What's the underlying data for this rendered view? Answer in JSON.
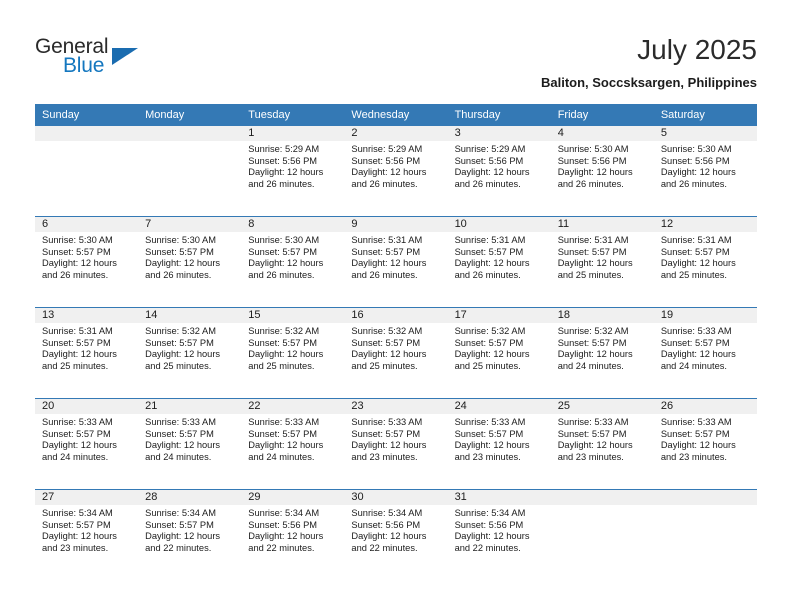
{
  "brand": {
    "name_top": "General",
    "name_bottom": "Blue",
    "triangle_icon": "triangle-icon",
    "color_dark": "#2a2a2a",
    "color_blue": "#1477bf"
  },
  "header": {
    "title": "July 2025",
    "subtitle": "Baliton, Soccsksargen, Philippines"
  },
  "theme": {
    "header_blue": "#3479b5",
    "daynum_band": "#f0f0f0",
    "text": "#1c1c1c"
  },
  "calendar": {
    "weekday_headers": [
      "Sunday",
      "Monday",
      "Tuesday",
      "Wednesday",
      "Thursday",
      "Friday",
      "Saturday"
    ],
    "labels": {
      "sunrise": "Sunrise:",
      "sunset": "Sunset:",
      "daylight": "Daylight:"
    },
    "weeks": [
      [
        {
          "day": ""
        },
        {
          "day": ""
        },
        {
          "day": "1",
          "sunrise": "Sunrise: 5:29 AM",
          "sunset": "Sunset: 5:56 PM",
          "daylight_1": "Daylight: 12 hours",
          "daylight_2": "and 26 minutes."
        },
        {
          "day": "2",
          "sunrise": "Sunrise: 5:29 AM",
          "sunset": "Sunset: 5:56 PM",
          "daylight_1": "Daylight: 12 hours",
          "daylight_2": "and 26 minutes."
        },
        {
          "day": "3",
          "sunrise": "Sunrise: 5:29 AM",
          "sunset": "Sunset: 5:56 PM",
          "daylight_1": "Daylight: 12 hours",
          "daylight_2": "and 26 minutes."
        },
        {
          "day": "4",
          "sunrise": "Sunrise: 5:30 AM",
          "sunset": "Sunset: 5:56 PM",
          "daylight_1": "Daylight: 12 hours",
          "daylight_2": "and 26 minutes."
        },
        {
          "day": "5",
          "sunrise": "Sunrise: 5:30 AM",
          "sunset": "Sunset: 5:56 PM",
          "daylight_1": "Daylight: 12 hours",
          "daylight_2": "and 26 minutes."
        }
      ],
      [
        {
          "day": "6",
          "sunrise": "Sunrise: 5:30 AM",
          "sunset": "Sunset: 5:57 PM",
          "daylight_1": "Daylight: 12 hours",
          "daylight_2": "and 26 minutes."
        },
        {
          "day": "7",
          "sunrise": "Sunrise: 5:30 AM",
          "sunset": "Sunset: 5:57 PM",
          "daylight_1": "Daylight: 12 hours",
          "daylight_2": "and 26 minutes."
        },
        {
          "day": "8",
          "sunrise": "Sunrise: 5:30 AM",
          "sunset": "Sunset: 5:57 PM",
          "daylight_1": "Daylight: 12 hours",
          "daylight_2": "and 26 minutes."
        },
        {
          "day": "9",
          "sunrise": "Sunrise: 5:31 AM",
          "sunset": "Sunset: 5:57 PM",
          "daylight_1": "Daylight: 12 hours",
          "daylight_2": "and 26 minutes."
        },
        {
          "day": "10",
          "sunrise": "Sunrise: 5:31 AM",
          "sunset": "Sunset: 5:57 PM",
          "daylight_1": "Daylight: 12 hours",
          "daylight_2": "and 26 minutes."
        },
        {
          "day": "11",
          "sunrise": "Sunrise: 5:31 AM",
          "sunset": "Sunset: 5:57 PM",
          "daylight_1": "Daylight: 12 hours",
          "daylight_2": "and 25 minutes."
        },
        {
          "day": "12",
          "sunrise": "Sunrise: 5:31 AM",
          "sunset": "Sunset: 5:57 PM",
          "daylight_1": "Daylight: 12 hours",
          "daylight_2": "and 25 minutes."
        }
      ],
      [
        {
          "day": "13",
          "sunrise": "Sunrise: 5:31 AM",
          "sunset": "Sunset: 5:57 PM",
          "daylight_1": "Daylight: 12 hours",
          "daylight_2": "and 25 minutes."
        },
        {
          "day": "14",
          "sunrise": "Sunrise: 5:32 AM",
          "sunset": "Sunset: 5:57 PM",
          "daylight_1": "Daylight: 12 hours",
          "daylight_2": "and 25 minutes."
        },
        {
          "day": "15",
          "sunrise": "Sunrise: 5:32 AM",
          "sunset": "Sunset: 5:57 PM",
          "daylight_1": "Daylight: 12 hours",
          "daylight_2": "and 25 minutes."
        },
        {
          "day": "16",
          "sunrise": "Sunrise: 5:32 AM",
          "sunset": "Sunset: 5:57 PM",
          "daylight_1": "Daylight: 12 hours",
          "daylight_2": "and 25 minutes."
        },
        {
          "day": "17",
          "sunrise": "Sunrise: 5:32 AM",
          "sunset": "Sunset: 5:57 PM",
          "daylight_1": "Daylight: 12 hours",
          "daylight_2": "and 25 minutes."
        },
        {
          "day": "18",
          "sunrise": "Sunrise: 5:32 AM",
          "sunset": "Sunset: 5:57 PM",
          "daylight_1": "Daylight: 12 hours",
          "daylight_2": "and 24 minutes."
        },
        {
          "day": "19",
          "sunrise": "Sunrise: 5:33 AM",
          "sunset": "Sunset: 5:57 PM",
          "daylight_1": "Daylight: 12 hours",
          "daylight_2": "and 24 minutes."
        }
      ],
      [
        {
          "day": "20",
          "sunrise": "Sunrise: 5:33 AM",
          "sunset": "Sunset: 5:57 PM",
          "daylight_1": "Daylight: 12 hours",
          "daylight_2": "and 24 minutes."
        },
        {
          "day": "21",
          "sunrise": "Sunrise: 5:33 AM",
          "sunset": "Sunset: 5:57 PM",
          "daylight_1": "Daylight: 12 hours",
          "daylight_2": "and 24 minutes."
        },
        {
          "day": "22",
          "sunrise": "Sunrise: 5:33 AM",
          "sunset": "Sunset: 5:57 PM",
          "daylight_1": "Daylight: 12 hours",
          "daylight_2": "and 24 minutes."
        },
        {
          "day": "23",
          "sunrise": "Sunrise: 5:33 AM",
          "sunset": "Sunset: 5:57 PM",
          "daylight_1": "Daylight: 12 hours",
          "daylight_2": "and 23 minutes."
        },
        {
          "day": "24",
          "sunrise": "Sunrise: 5:33 AM",
          "sunset": "Sunset: 5:57 PM",
          "daylight_1": "Daylight: 12 hours",
          "daylight_2": "and 23 minutes."
        },
        {
          "day": "25",
          "sunrise": "Sunrise: 5:33 AM",
          "sunset": "Sunset: 5:57 PM",
          "daylight_1": "Daylight: 12 hours",
          "daylight_2": "and 23 minutes."
        },
        {
          "day": "26",
          "sunrise": "Sunrise: 5:33 AM",
          "sunset": "Sunset: 5:57 PM",
          "daylight_1": "Daylight: 12 hours",
          "daylight_2": "and 23 minutes."
        }
      ],
      [
        {
          "day": "27",
          "sunrise": "Sunrise: 5:34 AM",
          "sunset": "Sunset: 5:57 PM",
          "daylight_1": "Daylight: 12 hours",
          "daylight_2": "and 23 minutes."
        },
        {
          "day": "28",
          "sunrise": "Sunrise: 5:34 AM",
          "sunset": "Sunset: 5:57 PM",
          "daylight_1": "Daylight: 12 hours",
          "daylight_2": "and 22 minutes."
        },
        {
          "day": "29",
          "sunrise": "Sunrise: 5:34 AM",
          "sunset": "Sunset: 5:56 PM",
          "daylight_1": "Daylight: 12 hours",
          "daylight_2": "and 22 minutes."
        },
        {
          "day": "30",
          "sunrise": "Sunrise: 5:34 AM",
          "sunset": "Sunset: 5:56 PM",
          "daylight_1": "Daylight: 12 hours",
          "daylight_2": "and 22 minutes."
        },
        {
          "day": "31",
          "sunrise": "Sunrise: 5:34 AM",
          "sunset": "Sunset: 5:56 PM",
          "daylight_1": "Daylight: 12 hours",
          "daylight_2": "and 22 minutes."
        },
        {
          "day": ""
        },
        {
          "day": ""
        }
      ]
    ]
  }
}
